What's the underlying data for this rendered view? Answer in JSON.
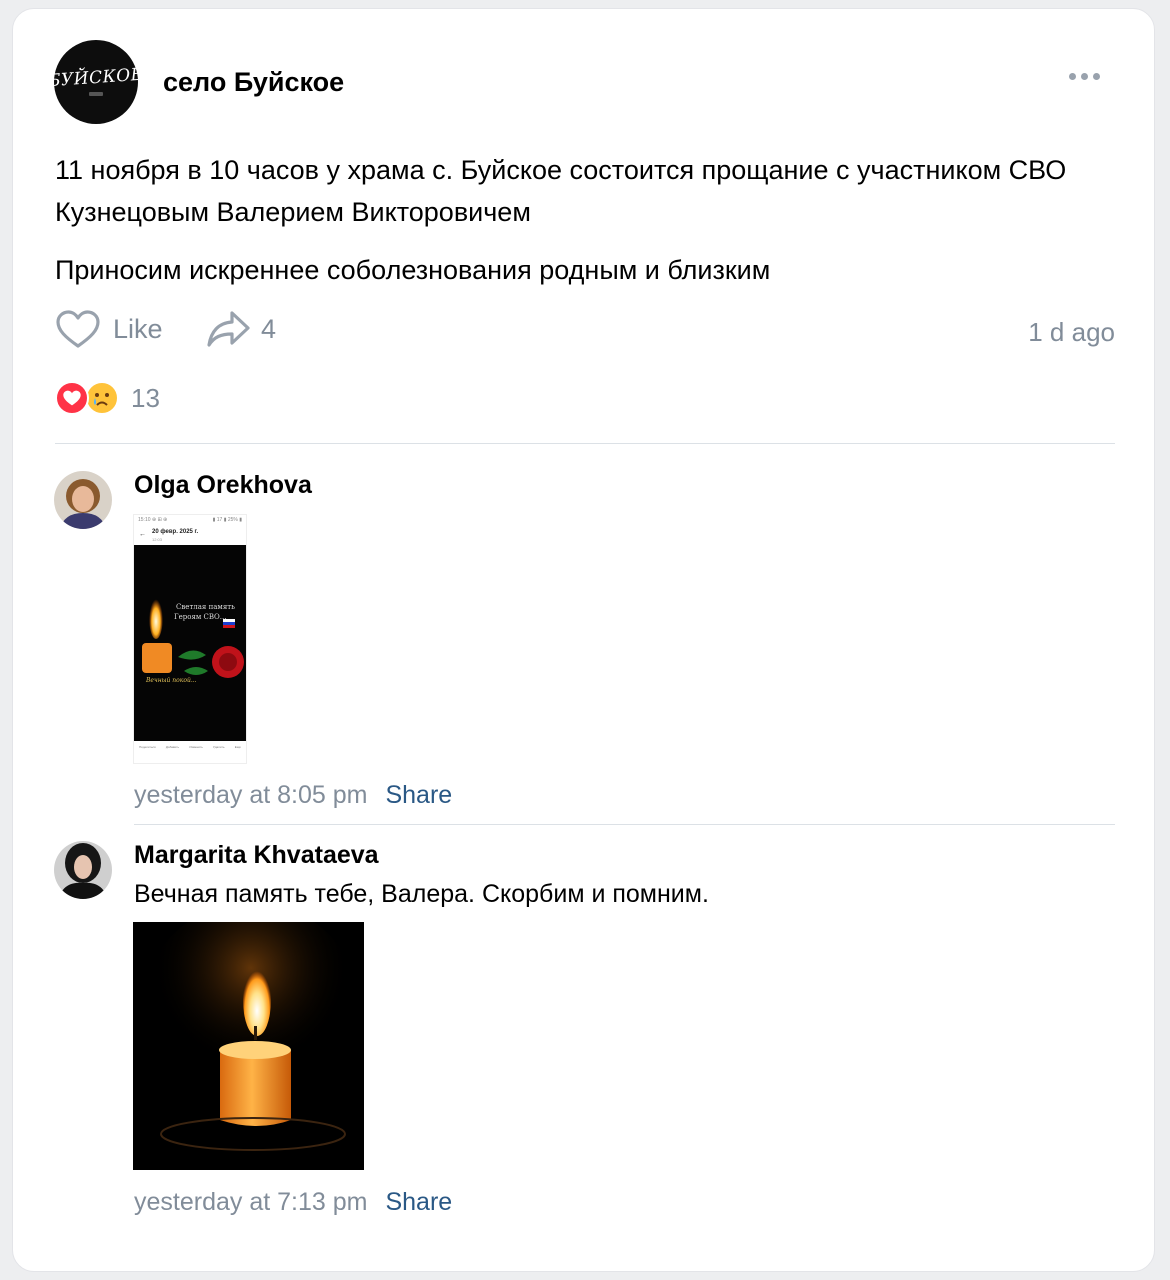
{
  "post": {
    "group_name": "село Буйское",
    "group_logo_text": "БУЙСКОЕ",
    "paragraphs": [
      "11 ноября в 10 часов у храма с. Буйское состоится прощание с участником СВО Кузнецовым Валерием Викторовичем",
      "Приносим искреннее соболезнования родным и близким"
    ],
    "like_label": "Like",
    "share_count": "4",
    "time": "1 d ago",
    "reactions": {
      "icons": [
        "heart-reaction",
        "crying-reaction"
      ],
      "count": "13"
    }
  },
  "comments": [
    {
      "author": "Olga Orekhova",
      "text": "",
      "attachment": {
        "type": "screenshot",
        "status_bar": "15:10 ⊕ ⊞ ⊕",
        "status_right": "▮ 17 ▮ 25% ▮",
        "date_header": "20 февр. 2025 г.",
        "date_sub": "12:03",
        "caption_line1": "Светлая память",
        "caption_line2": "Героям СВО...",
        "sign": "Вечный покой...",
        "toolbar": [
          "Поделиться",
          "Добавить",
          "Изменить",
          "Удалить",
          "Ещё"
        ]
      },
      "time": "yesterday at 8:05 pm",
      "share_label": "Share"
    },
    {
      "author": "Margarita Khvataeva",
      "text": "Вечная память тебе, Валера. Скорбим и помним.",
      "attachment": {
        "type": "candle-photo"
      },
      "time": "yesterday at 7:13 pm",
      "share_label": "Share"
    }
  ],
  "colors": {
    "background": "#edeef0",
    "card": "#ffffff",
    "secondary_text": "#818c99",
    "link": "#2a5885",
    "heart": "#ff3347"
  }
}
